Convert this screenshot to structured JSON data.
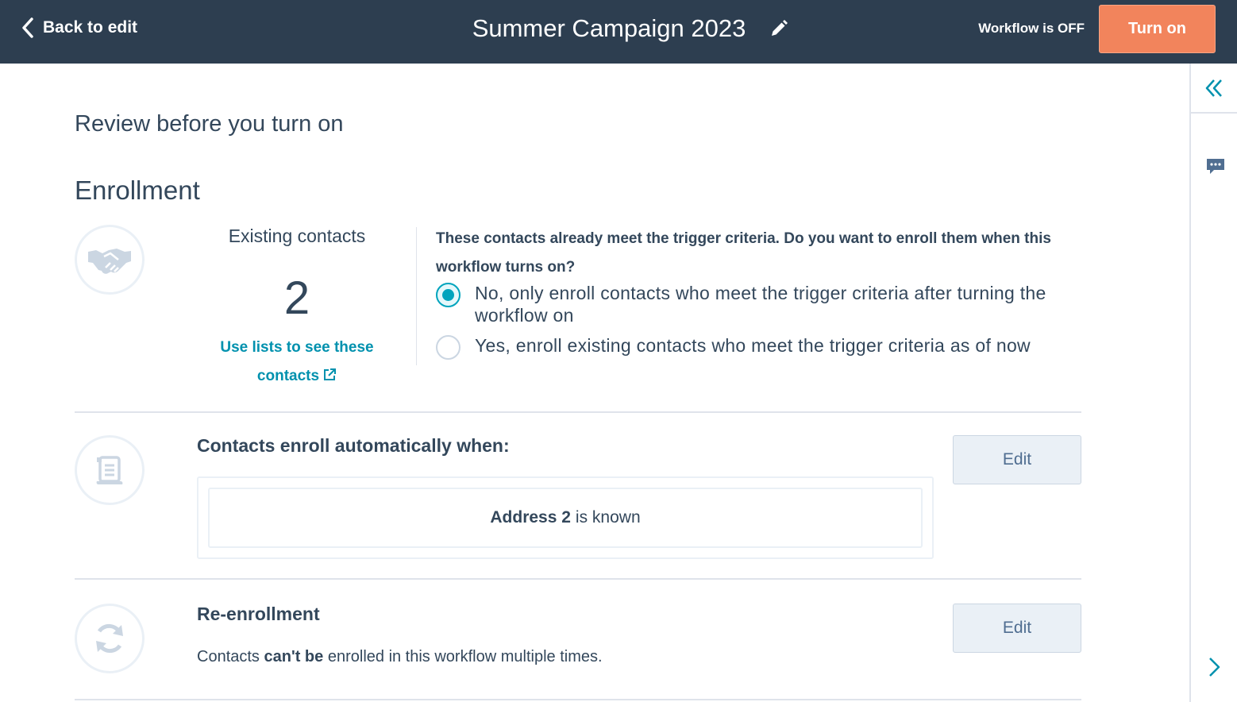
{
  "header": {
    "back_label": "Back to edit",
    "title": "Summer Campaign 2023",
    "workflow_status": "Workflow is OFF",
    "turn_on_label": "Turn on"
  },
  "colors": {
    "topbar": "#2d3e50",
    "accent_orange": "#f2845c",
    "link_teal": "#0091ae",
    "radio_teal": "#00a4bd"
  },
  "page": {
    "heading": "Review before you turn on",
    "section_title": "Enrollment"
  },
  "enrollment": {
    "icon": "handshake-icon",
    "existing_label": "Existing contacts",
    "existing_count": "2",
    "lists_link_label": "Use lists to see these contacts",
    "question": "These contacts already meet the trigger criteria. Do you want to enroll them when this workflow turns on?",
    "options": [
      {
        "label": "No, only enroll contacts who meet the trigger criteria after turning the workflow on",
        "selected": true
      },
      {
        "label": "Yes, enroll existing contacts who meet the trigger criteria as of now",
        "selected": false
      }
    ]
  },
  "triggers": {
    "icon": "scroll-icon",
    "heading": "Contacts enroll automatically when:",
    "edit_label": "Edit",
    "criteria_property": "Address 2",
    "criteria_condition": "is known"
  },
  "reenrollment": {
    "icon": "refresh-icon",
    "heading": "Re-enrollment",
    "edit_label": "Edit",
    "desc_prefix": "Contacts",
    "desc_emphasis": "can't be",
    "desc_suffix": "enrolled in this workflow multiple times."
  },
  "rail": {
    "icons": [
      "collapse-icon",
      "comment-icon",
      "chevron-right-icon"
    ]
  }
}
